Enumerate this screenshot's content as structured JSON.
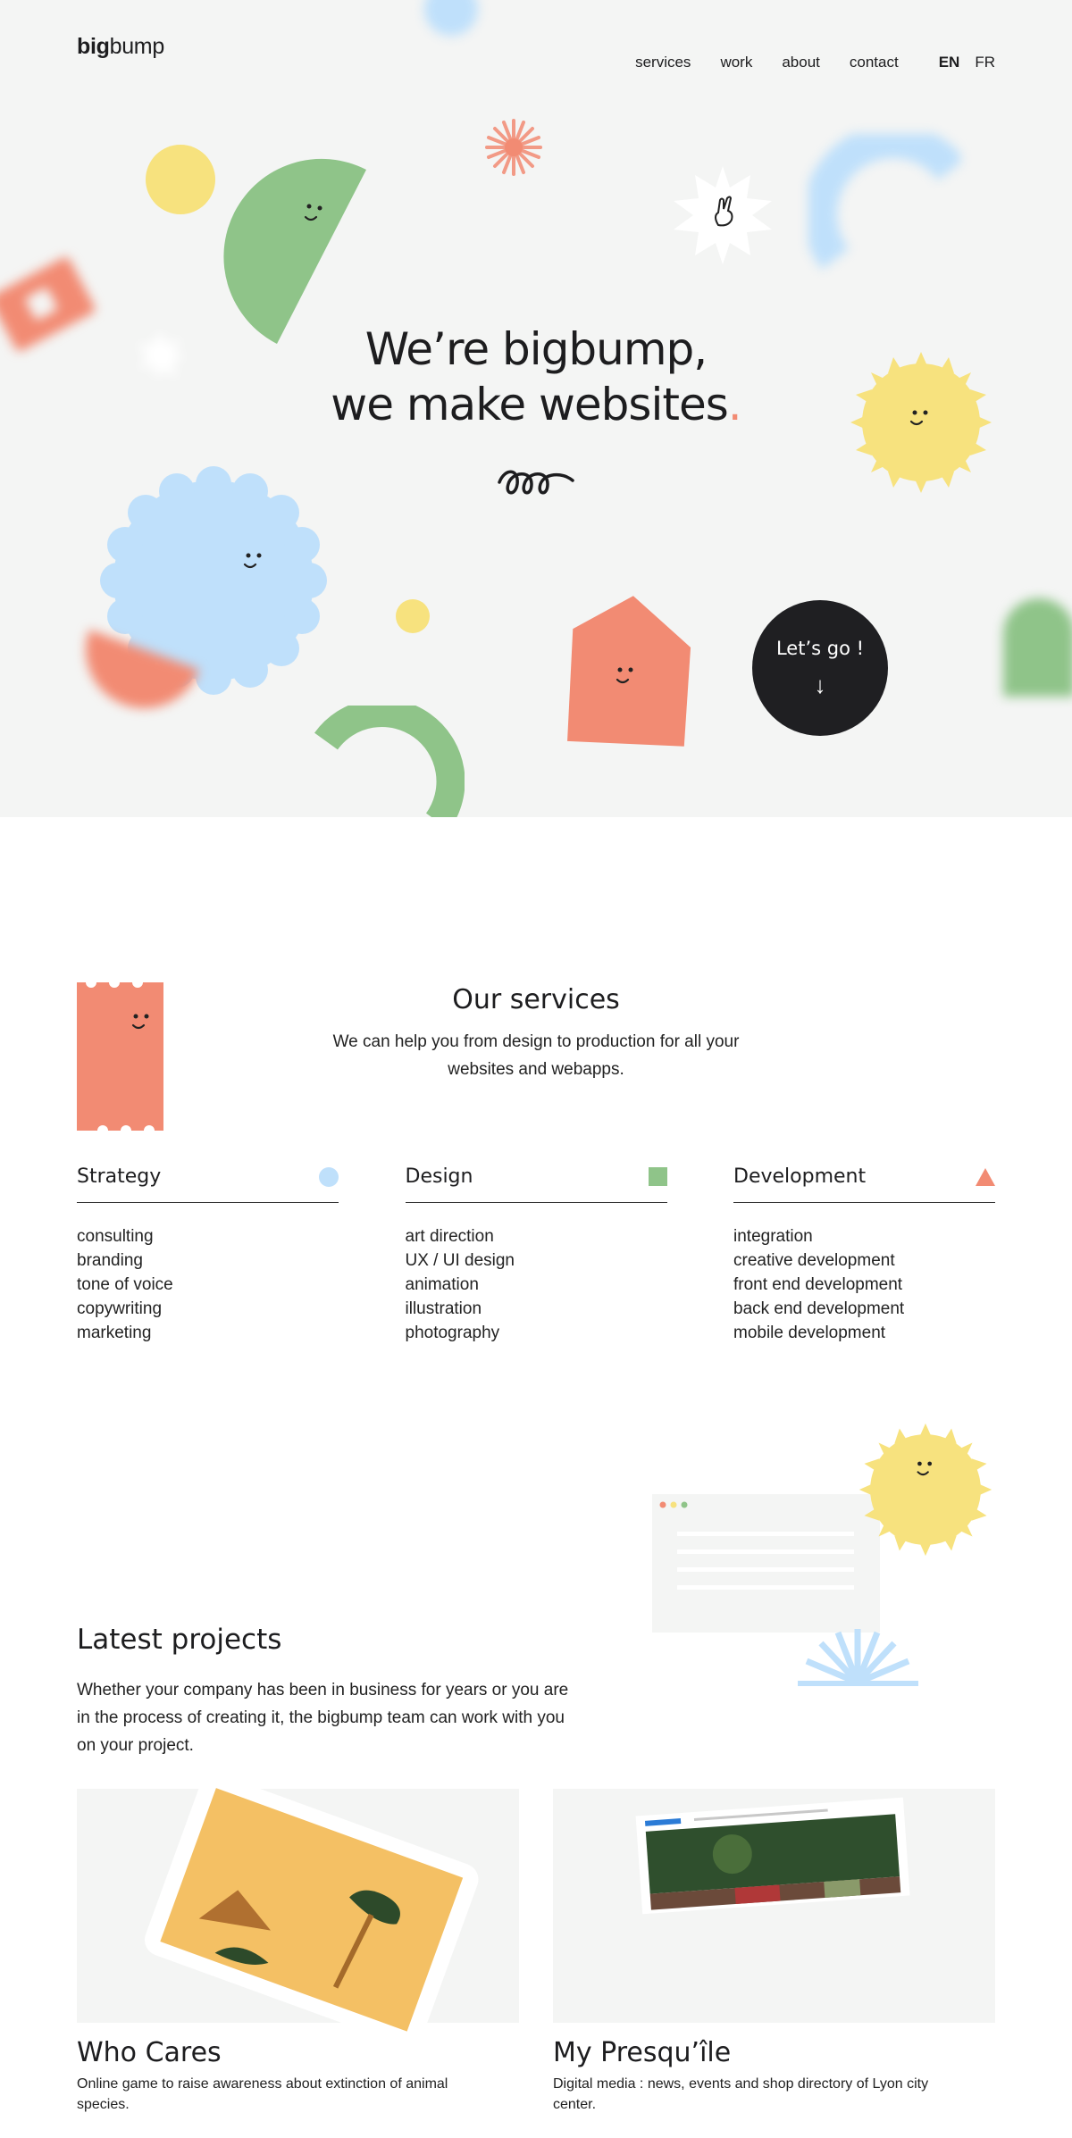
{
  "header": {
    "logo_bold": "big",
    "logo_rest": "bump",
    "nav": [
      "services",
      "work",
      "about",
      "contact"
    ],
    "lang_active": "EN",
    "lang_other": "FR"
  },
  "hero": {
    "title_line1": "We’re bigbump,",
    "title_line2": "we make websites",
    "title_dot": ".",
    "cta_label": "Let’s go !",
    "cta_arrow": "↓"
  },
  "services": {
    "title": "Our services",
    "description": "We can help you from design to production for all your websites and webapps.",
    "columns": [
      {
        "title": "Strategy",
        "icon": "circle-icon",
        "color": "#bfe0fb",
        "items": [
          "consulting",
          "branding",
          "tone of voice",
          "copywriting",
          "marketing"
        ]
      },
      {
        "title": "Design",
        "icon": "square-icon",
        "color": "#8fc489",
        "items": [
          "art direction",
          "UX / UI design",
          "animation",
          "illustration",
          "photography"
        ]
      },
      {
        "title": "Development",
        "icon": "triangle-icon",
        "color": "#f28b73",
        "items": [
          "integration",
          "creative development",
          "front end development",
          "back end development",
          "mobile development"
        ]
      }
    ]
  },
  "projects": {
    "title": "Latest projects",
    "description": "Whether your company has been in business for years or you are in the process of creating it, the bigbump team can work with you on your project.",
    "items": [
      {
        "name": "Who Cares",
        "description": "Online game to raise awareness about extinction of animal species."
      },
      {
        "name": "My Presqu’île",
        "description": "Digital media : news, events and shop directory of Lyon city center."
      }
    ]
  },
  "colors": {
    "yellow": "#f7e27e",
    "green": "#8fc489",
    "blue": "#bfe0fb",
    "salmon": "#f28b73",
    "dark": "#1f1f22",
    "hero_bg": "#f4f5f4"
  }
}
